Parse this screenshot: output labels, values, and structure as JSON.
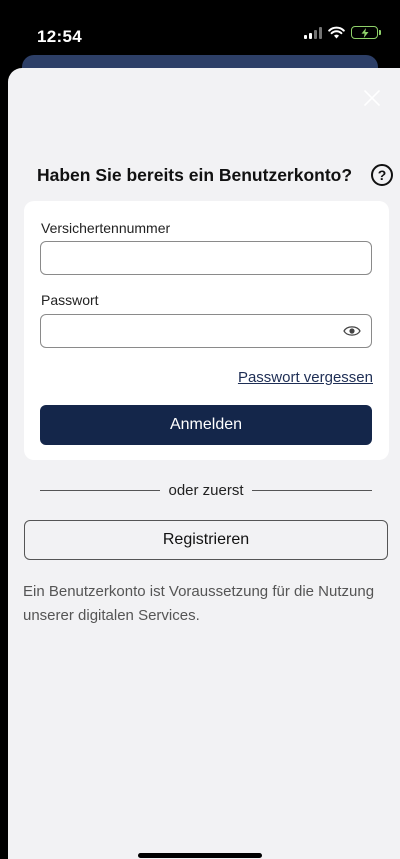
{
  "status_bar": {
    "time": "12:54"
  },
  "dialog": {
    "title": "Haben Sie bereits ein Benutzerkonto?",
    "help_icon": "question-circle-icon",
    "close_icon": "close-icon"
  },
  "login_form": {
    "insurance_number_label": "Versichertennummer",
    "insurance_number_value": "",
    "password_label": "Passwort",
    "password_value": "",
    "password_toggle_icon": "eye-icon",
    "forgot_password_link": "Passwort vergessen",
    "login_button": "Anmelden"
  },
  "divider_text": "oder zuerst",
  "register_button": "Registrieren",
  "info_text": "Ein Benutzerkonto ist Voraussetzung für die Nutzung unserer digitalen Services.",
  "colors": {
    "primary": "#14264a",
    "link": "#1e2e55",
    "background": "#f2f2f4",
    "card": "#ffffff"
  }
}
